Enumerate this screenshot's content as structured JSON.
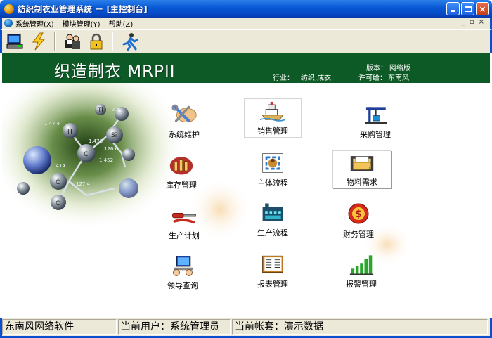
{
  "window": {
    "title": "纺织制衣业管理系统 － [主控制台]"
  },
  "menu": {
    "items": [
      {
        "label": "系统管理(X)"
      },
      {
        "label": "模块管理(Y)"
      },
      {
        "label": "帮助(Z)"
      }
    ],
    "mdi_controls": [
      "_",
      "▫",
      "×"
    ]
  },
  "toolbar": {
    "buttons": [
      "computer-icon",
      "lightning-icon",
      "users-icon",
      "lock-icon",
      "runner-icon"
    ]
  },
  "banner": {
    "title": "织造制衣 MRPII",
    "version_label": "版本：",
    "version_value": "网络版",
    "industry_label": "行业：",
    "industry_value": "纺织,成衣",
    "license_label": "许可给：",
    "license_value": "东南风"
  },
  "decor_molecule": {
    "atoms": [
      "H",
      "C",
      "C",
      "C",
      "Ti",
      "Si"
    ],
    "values": [
      "1.478",
      "1.47.4",
      "1.414",
      "1.452",
      "7.4",
      "126.6",
      "127.4"
    ]
  },
  "modules": [
    {
      "label": "系统维护",
      "icon": "tools-icon"
    },
    {
      "label": "销售管理",
      "icon": "ship-icon"
    },
    {
      "label": "采购管理",
      "icon": "crane-icon"
    },
    {
      "label": "库存管理",
      "icon": "warehouse-icon"
    },
    {
      "label": "主体流程",
      "icon": "flow-cycle-icon"
    },
    {
      "label": "物料需求",
      "icon": "folder-icon"
    },
    {
      "label": "生产计划",
      "icon": "screwdriver-icon"
    },
    {
      "label": "生产流程",
      "icon": "factory-icon"
    },
    {
      "label": "财务管理",
      "icon": "dollar-icon"
    },
    {
      "label": "领导查询",
      "icon": "computer-user-icon"
    },
    {
      "label": "报表管理",
      "icon": "document-icon"
    },
    {
      "label": "报警管理",
      "icon": "bar-chart-icon"
    }
  ],
  "status": {
    "company": "东南风网络软件",
    "user": "当前用户：系统管理员",
    "account": "当前帐套：演示数据"
  },
  "colors": {
    "banner": "#0e5a26",
    "titlebar": "#0a5bd6",
    "chrome": "#ece9d8"
  }
}
